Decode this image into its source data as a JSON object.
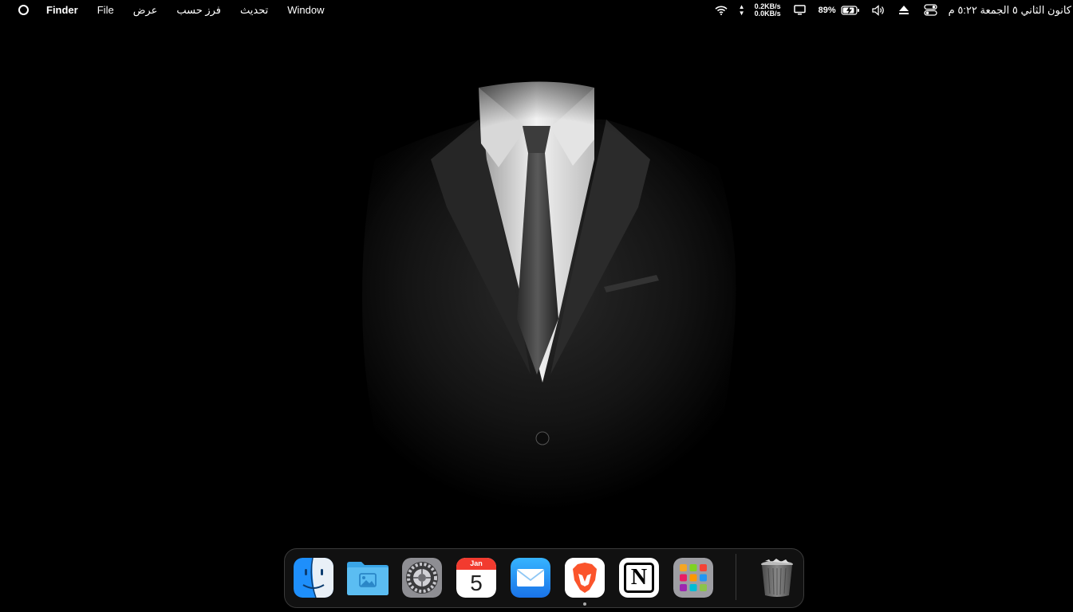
{
  "menubar": {
    "app_name": "Finder",
    "items": [
      "File",
      "عرض",
      "فرز حسب",
      "تحديث",
      "Window"
    ],
    "network": {
      "up": "0.2KB/s",
      "down": "0.0KB/s"
    },
    "battery_percent": "89%",
    "datetime": "كانون الثاني ٥ الجمعة ٥:٢٢ م",
    "status_icons": [
      "wifi-icon",
      "network-arrows-icon",
      "display-icon",
      "battery-charging-icon",
      "volume-icon",
      "eject-icon",
      "control-center-icon"
    ]
  },
  "desktop": {
    "wallpaper": "dark-suit-portrait"
  },
  "dock": {
    "apps": [
      {
        "name": "Finder",
        "icon": "finder-icon"
      },
      {
        "name": "Photos Folder",
        "icon": "folder-photos-icon"
      },
      {
        "name": "System Settings",
        "icon": "settings-gear-icon"
      },
      {
        "name": "Calendar",
        "icon": "calendar-icon",
        "month": "Jan",
        "day": "5"
      },
      {
        "name": "Mail",
        "icon": "mail-icon"
      },
      {
        "name": "Brave",
        "icon": "brave-lion-icon",
        "running": true
      },
      {
        "name": "Notion",
        "icon": "notion-icon",
        "letter": "N"
      },
      {
        "name": "Launchpad",
        "icon": "launchpad-grid-icon"
      }
    ],
    "trash": {
      "name": "Trash",
      "icon": "trash-icon"
    }
  },
  "colors": {
    "menubar_text": "#ffffff",
    "background": "#000000",
    "dock_border": "#3a3a3a",
    "finder_blue": "#1e8ffb",
    "folder_blue": "#5bbdf2",
    "mail_blue": "#2a9af2",
    "brave_orange": "#fb542b"
  }
}
